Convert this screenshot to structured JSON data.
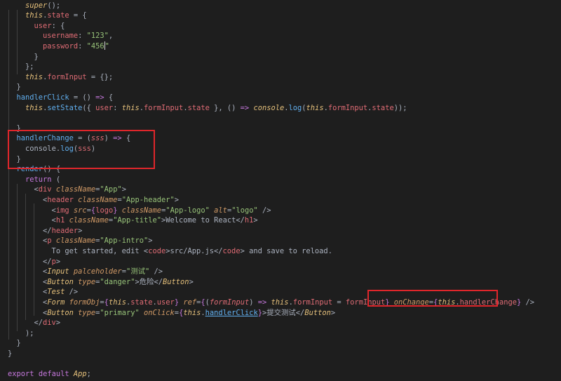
{
  "editor": {
    "language": "javascript-jsx",
    "lines": [
      [
        {
          "t": "    "
        },
        {
          "t": "super",
          "c": "super"
        },
        {
          "t": "();",
          "c": "punct"
        }
      ],
      [
        {
          "t": "    "
        },
        {
          "t": "this",
          "c": "this"
        },
        {
          "t": ".",
          "c": "punct"
        },
        {
          "t": "state",
          "c": "prop"
        },
        {
          "t": " = {",
          "c": "punct"
        }
      ],
      [
        {
          "t": "      "
        },
        {
          "t": "user",
          "c": "prop"
        },
        {
          "t": ": {",
          "c": "punct"
        }
      ],
      [
        {
          "t": "        "
        },
        {
          "t": "username",
          "c": "prop"
        },
        {
          "t": ": ",
          "c": "punct"
        },
        {
          "t": "\"123\"",
          "c": "str"
        },
        {
          "t": ",",
          "c": "punct"
        }
      ],
      [
        {
          "t": "        "
        },
        {
          "t": "password",
          "c": "prop"
        },
        {
          "t": ": ",
          "c": "punct"
        },
        {
          "t": "\"456",
          "c": "str"
        },
        {
          "t": "",
          "c": "cursor"
        },
        {
          "t": "\"",
          "c": "str"
        }
      ],
      [
        {
          "t": "      }",
          "c": "punct"
        }
      ],
      [
        {
          "t": "    };",
          "c": "punct"
        }
      ],
      [
        {
          "t": "    "
        },
        {
          "t": "this",
          "c": "this"
        },
        {
          "t": ".",
          "c": "punct"
        },
        {
          "t": "formInput",
          "c": "prop"
        },
        {
          "t": " = {};",
          "c": "punct"
        }
      ],
      [
        {
          "t": "  }",
          "c": "punct"
        }
      ],
      [
        {
          "t": "  "
        },
        {
          "t": "handlerClick",
          "c": "fn"
        },
        {
          "t": " = () ",
          "c": "punct"
        },
        {
          "t": "=>",
          "c": "kw"
        },
        {
          "t": " {",
          "c": "punct"
        }
      ],
      [
        {
          "t": "    "
        },
        {
          "t": "this",
          "c": "this"
        },
        {
          "t": ".",
          "c": "punct"
        },
        {
          "t": "setState",
          "c": "fn"
        },
        {
          "t": "({ ",
          "c": "punct"
        },
        {
          "t": "user",
          "c": "prop"
        },
        {
          "t": ": ",
          "c": "punct"
        },
        {
          "t": "this",
          "c": "this"
        },
        {
          "t": ".",
          "c": "punct"
        },
        {
          "t": "formInput",
          "c": "prop"
        },
        {
          "t": ".",
          "c": "punct"
        },
        {
          "t": "state",
          "c": "prop"
        },
        {
          "t": " }, () ",
          "c": "punct"
        },
        {
          "t": "=>",
          "c": "kw"
        },
        {
          "t": " ",
          "c": "punct"
        },
        {
          "t": "console",
          "c": "this"
        },
        {
          "t": ".",
          "c": "punct"
        },
        {
          "t": "log",
          "c": "fn"
        },
        {
          "t": "(",
          "c": "punct"
        },
        {
          "t": "this",
          "c": "this"
        },
        {
          "t": ".",
          "c": "punct"
        },
        {
          "t": "formInput",
          "c": "prop"
        },
        {
          "t": ".",
          "c": "punct"
        },
        {
          "t": "state",
          "c": "prop"
        },
        {
          "t": "));",
          "c": "punct"
        }
      ],
      [],
      [
        {
          "t": "  }",
          "c": "punct"
        }
      ],
      [
        {
          "t": "  "
        },
        {
          "t": "handlerChange",
          "c": "fn"
        },
        {
          "t": " = (",
          "c": "punct"
        },
        {
          "t": "sss",
          "c": "param"
        },
        {
          "t": ") ",
          "c": "punct"
        },
        {
          "t": "=>",
          "c": "kw"
        },
        {
          "t": " {",
          "c": "punct"
        }
      ],
      [
        {
          "t": "    "
        },
        {
          "t": "console",
          "c": "plain"
        },
        {
          "t": ".",
          "c": "punct"
        },
        {
          "t": "log",
          "c": "fn"
        },
        {
          "t": "(",
          "c": "punct"
        },
        {
          "t": "sss",
          "c": "prop"
        },
        {
          "t": ")",
          "c": "punct"
        }
      ],
      [
        {
          "t": "  }",
          "c": "punct"
        }
      ],
      [
        {
          "t": "  "
        },
        {
          "t": "render",
          "c": "fn"
        },
        {
          "t": "() {",
          "c": "punct"
        }
      ],
      [
        {
          "t": "    "
        },
        {
          "t": "return",
          "c": "kw"
        },
        {
          "t": " (",
          "c": "punct"
        }
      ],
      [
        {
          "t": "      <",
          "c": "punct"
        },
        {
          "t": "div",
          "c": "tag"
        },
        {
          "t": " "
        },
        {
          "t": "className",
          "c": "attr"
        },
        {
          "t": "=",
          "c": "punct"
        },
        {
          "t": "\"App\"",
          "c": "str"
        },
        {
          "t": ">",
          "c": "punct"
        }
      ],
      [
        {
          "t": "        <",
          "c": "punct"
        },
        {
          "t": "header",
          "c": "tag"
        },
        {
          "t": " "
        },
        {
          "t": "className",
          "c": "attr"
        },
        {
          "t": "=",
          "c": "punct"
        },
        {
          "t": "\"App-header\"",
          "c": "str"
        },
        {
          "t": ">",
          "c": "punct"
        }
      ],
      [
        {
          "t": "          <",
          "c": "punct"
        },
        {
          "t": "img",
          "c": "tag"
        },
        {
          "t": " "
        },
        {
          "t": "src",
          "c": "attr"
        },
        {
          "t": "=",
          "c": "punct"
        },
        {
          "t": "{",
          "c": "brace"
        },
        {
          "t": "logo",
          "c": "prop"
        },
        {
          "t": "}",
          "c": "brace"
        },
        {
          "t": " "
        },
        {
          "t": "className",
          "c": "attr"
        },
        {
          "t": "=",
          "c": "punct"
        },
        {
          "t": "\"App-logo\"",
          "c": "str"
        },
        {
          "t": " "
        },
        {
          "t": "alt",
          "c": "attr"
        },
        {
          "t": "=",
          "c": "punct"
        },
        {
          "t": "\"logo\"",
          "c": "str"
        },
        {
          "t": " />",
          "c": "punct"
        }
      ],
      [
        {
          "t": "          <",
          "c": "punct"
        },
        {
          "t": "h1",
          "c": "tag"
        },
        {
          "t": " "
        },
        {
          "t": "className",
          "c": "attr"
        },
        {
          "t": "=",
          "c": "punct"
        },
        {
          "t": "\"App-title\"",
          "c": "str"
        },
        {
          "t": ">Welcome to React</",
          "c": "punct"
        },
        {
          "t": "h1",
          "c": "tag"
        },
        {
          "t": ">",
          "c": "punct"
        }
      ],
      [
        {
          "t": "        </",
          "c": "punct"
        },
        {
          "t": "header",
          "c": "tag"
        },
        {
          "t": ">",
          "c": "punct"
        }
      ],
      [
        {
          "t": "        <",
          "c": "punct"
        },
        {
          "t": "p",
          "c": "tag"
        },
        {
          "t": " "
        },
        {
          "t": "className",
          "c": "attr"
        },
        {
          "t": "=",
          "c": "punct"
        },
        {
          "t": "\"App-intro\"",
          "c": "str"
        },
        {
          "t": ">",
          "c": "punct"
        }
      ],
      [
        {
          "t": "          To get started, edit <",
          "c": "punct"
        },
        {
          "t": "code",
          "c": "tag"
        },
        {
          "t": ">src/App.js</",
          "c": "punct"
        },
        {
          "t": "code",
          "c": "tag"
        },
        {
          "t": "> and save to reload.",
          "c": "punct"
        }
      ],
      [
        {
          "t": "        </",
          "c": "punct"
        },
        {
          "t": "p",
          "c": "tag"
        },
        {
          "t": ">",
          "c": "punct"
        }
      ],
      [
        {
          "t": "        <",
          "c": "punct"
        },
        {
          "t": "Input",
          "c": "this"
        },
        {
          "t": " "
        },
        {
          "t": "palceholder",
          "c": "attr"
        },
        {
          "t": "=",
          "c": "punct"
        },
        {
          "t": "\"测试\"",
          "c": "str"
        },
        {
          "t": " />",
          "c": "punct"
        }
      ],
      [
        {
          "t": "        <",
          "c": "punct"
        },
        {
          "t": "Button",
          "c": "this"
        },
        {
          "t": " "
        },
        {
          "t": "type",
          "c": "attr"
        },
        {
          "t": "=",
          "c": "punct"
        },
        {
          "t": "\"danger\"",
          "c": "str"
        },
        {
          "t": ">危险</",
          "c": "punct"
        },
        {
          "t": "Button",
          "c": "this"
        },
        {
          "t": ">",
          "c": "punct"
        }
      ],
      [
        {
          "t": "        <",
          "c": "punct"
        },
        {
          "t": "Test",
          "c": "this"
        },
        {
          "t": " />",
          "c": "punct"
        }
      ],
      [
        {
          "t": "        <",
          "c": "punct"
        },
        {
          "t": "Form",
          "c": "this"
        },
        {
          "t": " "
        },
        {
          "t": "formObj",
          "c": "attr"
        },
        {
          "t": "=",
          "c": "punct"
        },
        {
          "t": "{",
          "c": "brace"
        },
        {
          "t": "this",
          "c": "this"
        },
        {
          "t": ".",
          "c": "punct"
        },
        {
          "t": "state",
          "c": "prop"
        },
        {
          "t": ".",
          "c": "punct"
        },
        {
          "t": "user",
          "c": "prop"
        },
        {
          "t": "}",
          "c": "brace"
        },
        {
          "t": " "
        },
        {
          "t": "ref",
          "c": "attr"
        },
        {
          "t": "=",
          "c": "punct"
        },
        {
          "t": "{",
          "c": "brace"
        },
        {
          "t": "(",
          "c": "punct"
        },
        {
          "t": "formInput",
          "c": "param"
        },
        {
          "t": ") ",
          "c": "punct"
        },
        {
          "t": "=>",
          "c": "kw"
        },
        {
          "t": " "
        },
        {
          "t": "this",
          "c": "this"
        },
        {
          "t": ".",
          "c": "punct"
        },
        {
          "t": "formInput",
          "c": "prop"
        },
        {
          "t": " = ",
          "c": "punct"
        },
        {
          "t": "formInput",
          "c": "prop"
        },
        {
          "t": "}",
          "c": "brace"
        },
        {
          "t": " "
        },
        {
          "t": "onChange",
          "c": "attr"
        },
        {
          "t": "=",
          "c": "punct"
        },
        {
          "t": "{",
          "c": "brace"
        },
        {
          "t": "this",
          "c": "this"
        },
        {
          "t": ".",
          "c": "punct"
        },
        {
          "t": "handlerChange",
          "c": "prop"
        },
        {
          "t": "}",
          "c": "brace"
        },
        {
          "t": " />",
          "c": "punct"
        }
      ],
      [
        {
          "t": "        <",
          "c": "punct"
        },
        {
          "t": "Button",
          "c": "this"
        },
        {
          "t": " "
        },
        {
          "t": "type",
          "c": "attr"
        },
        {
          "t": "=",
          "c": "punct"
        },
        {
          "t": "\"primary\"",
          "c": "str"
        },
        {
          "t": " "
        },
        {
          "t": "onClick",
          "c": "attr"
        },
        {
          "t": "=",
          "c": "punct"
        },
        {
          "t": "{",
          "c": "brace"
        },
        {
          "t": "this",
          "c": "this"
        },
        {
          "t": ".",
          "c": "punct"
        },
        {
          "t": "handlerClick",
          "c": "fn",
          "u": true
        },
        {
          "t": "}",
          "c": "brace"
        },
        {
          "t": ">提交测试</",
          "c": "punct"
        },
        {
          "t": "Button",
          "c": "this"
        },
        {
          "t": ">",
          "c": "punct"
        }
      ],
      [
        {
          "t": "      </",
          "c": "punct"
        },
        {
          "t": "div",
          "c": "tag"
        },
        {
          "t": ">",
          "c": "punct"
        }
      ],
      [
        {
          "t": "    );",
          "c": "punct"
        }
      ],
      [
        {
          "t": "  }",
          "c": "punct"
        }
      ],
      [
        {
          "t": "}",
          "c": "punct"
        }
      ],
      [],
      [
        {
          "t": "export",
          "c": "kw"
        },
        {
          "t": " "
        },
        {
          "t": "default",
          "c": "kw"
        },
        {
          "t": " "
        },
        {
          "t": "App",
          "c": "this"
        },
        {
          "t": ";",
          "c": "punct"
        }
      ]
    ]
  },
  "colors": {
    "background": "#1e1e1e",
    "highlight_border": "#e0262b"
  }
}
